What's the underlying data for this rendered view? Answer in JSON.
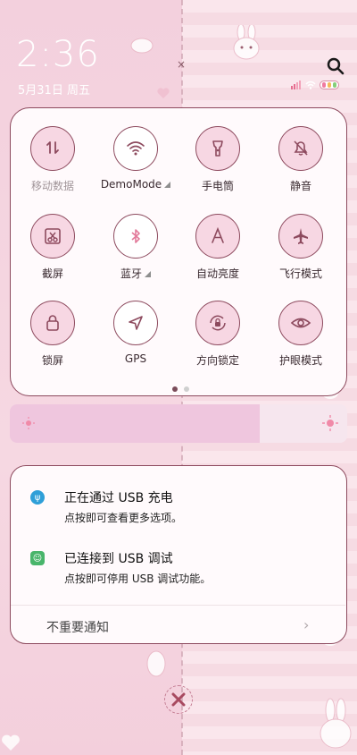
{
  "clock": {
    "time": "2:36",
    "date": "5月31日 周五"
  },
  "icons": {
    "search": "search-icon"
  },
  "colors": {
    "accent": "#8d4a5e",
    "tile_on": "#f7d7e3",
    "usb_blue": "#2f9fd8",
    "debug_green": "#49b56b"
  },
  "quick_settings": {
    "tiles": [
      {
        "key": "mobile-data",
        "label": "移动数据",
        "icon": "mobile-data-icon",
        "active": true,
        "dim": true
      },
      {
        "key": "wifi",
        "label": "DemoMode",
        "icon": "wifi-icon",
        "active": false,
        "has_more": true
      },
      {
        "key": "flashlight",
        "label": "手电筒",
        "icon": "flashlight-icon",
        "active": true
      },
      {
        "key": "mute",
        "label": "静音",
        "icon": "mute-bell-icon",
        "active": true
      },
      {
        "key": "screenshot",
        "label": "截屏",
        "icon": "screenshot-scissors-icon",
        "active": true
      },
      {
        "key": "bluetooth",
        "label": "蓝牙",
        "icon": "bluetooth-icon",
        "active": false,
        "has_more": true
      },
      {
        "key": "auto-brightness",
        "label": "自动亮度",
        "icon": "auto-brightness-icon",
        "active": true
      },
      {
        "key": "airplane",
        "label": "飞行模式",
        "icon": "airplane-icon",
        "active": true
      },
      {
        "key": "lock-screen",
        "label": "锁屏",
        "icon": "lock-icon",
        "active": true
      },
      {
        "key": "gps",
        "label": "GPS",
        "icon": "gps-arrow-icon",
        "active": false
      },
      {
        "key": "rotation-lock",
        "label": "方向锁定",
        "icon": "rotation-lock-icon",
        "active": true
      },
      {
        "key": "eye-care",
        "label": "护眼模式",
        "icon": "eye-icon",
        "active": true
      }
    ],
    "page_count": 2,
    "current_page": 1
  },
  "brightness": {
    "level": 0.74
  },
  "notifications": [
    {
      "title": "正在通过 USB 充电",
      "subtitle": "点按即可查看更多选项。",
      "icon": "usb-icon"
    },
    {
      "title": "已连接到 USB 调试",
      "subtitle": "点按即可停用 USB 调试功能。",
      "icon": "android-debug-icon"
    }
  ],
  "unimportant": {
    "label": "不重要通知"
  }
}
